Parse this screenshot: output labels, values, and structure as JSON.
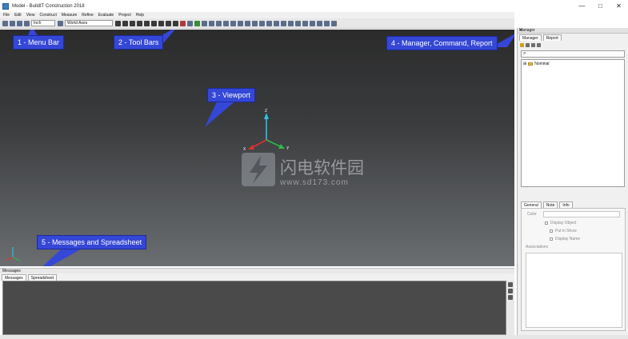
{
  "window": {
    "title": "Model - BuildIT Construction 2018",
    "controls": [
      "—",
      "□",
      "✕"
    ]
  },
  "menu": [
    "File",
    "Edit",
    "View",
    "Construct",
    "Measure",
    "Refine",
    "Evaluate",
    "Project",
    "Help"
  ],
  "toolbar": {
    "units": "Inch",
    "axes": "World Axes"
  },
  "viewport": {
    "axis_labels": {
      "z": "Z",
      "y": "Y",
      "x": "X"
    }
  },
  "callouts": {
    "menu_bar": "1 - Menu Bar",
    "tool_bars": "2 - Tool Bars",
    "viewport": "3 - Viewport",
    "manager": "4 - Manager, Command, Report",
    "messages": "5 - Messages and Spreadsheet"
  },
  "messages_panel": {
    "header": "Messages",
    "tabs": [
      "Messages",
      "Spreadsheet"
    ]
  },
  "manager": {
    "header": "Manager",
    "tabs": [
      "Manager",
      "Report"
    ],
    "tree_item": "Nominal",
    "props_tabs": [
      "General",
      "Note",
      "Info"
    ],
    "color_label": "Color",
    "display_object": "Display Object",
    "put_in_show": "Put in Show",
    "display_name": "Display Name",
    "associations": "Associations"
  },
  "watermark": {
    "title": "闪电软件园",
    "url": "www.sd173.com"
  },
  "colors": {
    "callout": "#3447d6",
    "viewport_top": "#2b2b2b",
    "viewport_bottom": "#6b6e71",
    "axis_x": "#e03030",
    "axis_y": "#2fb84a",
    "axis_z": "#2fbfe0"
  }
}
